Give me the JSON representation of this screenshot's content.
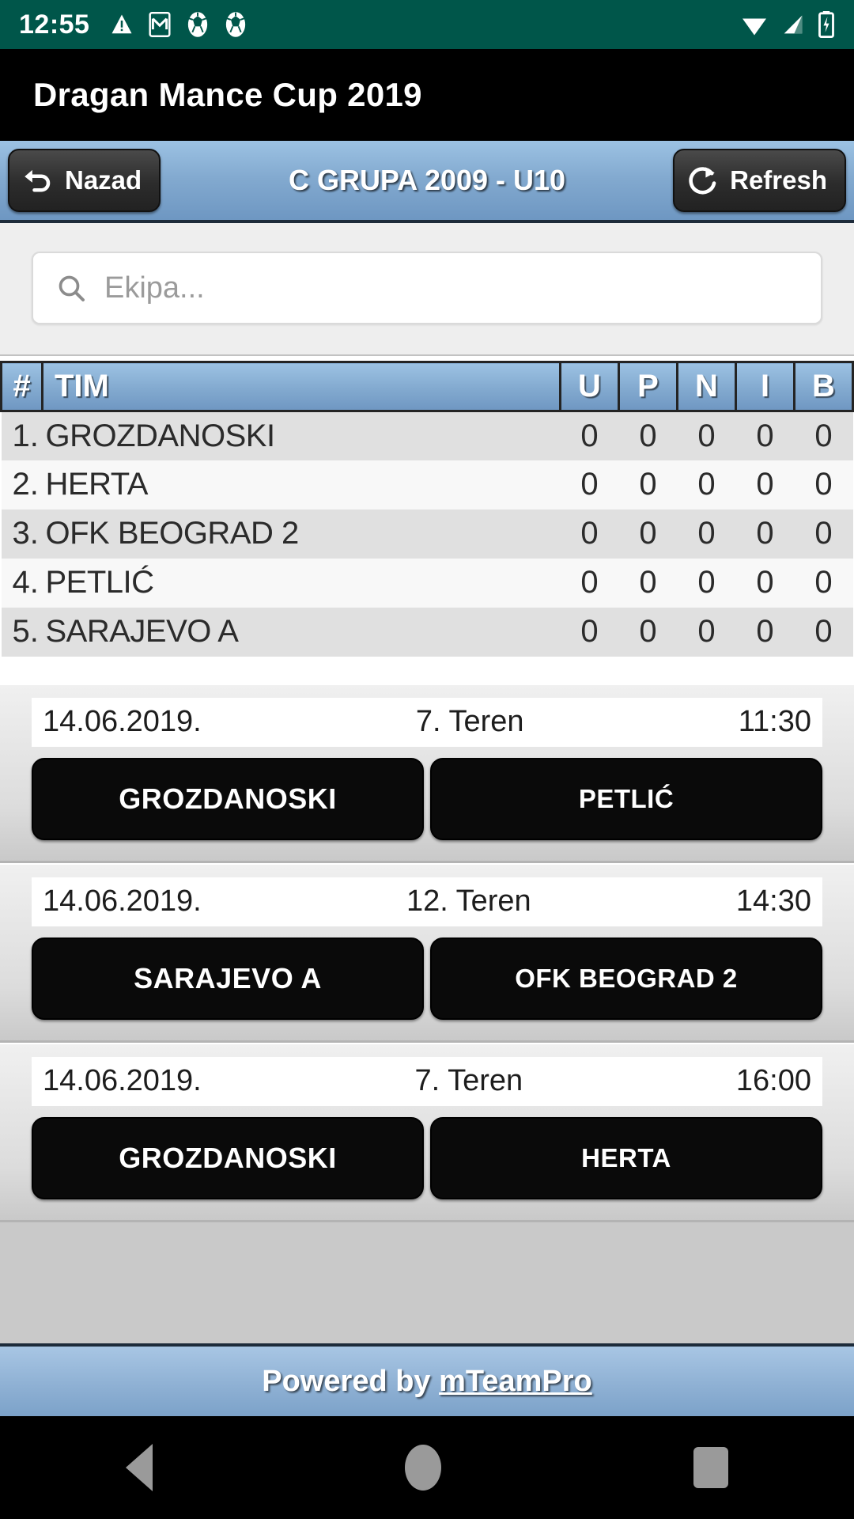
{
  "statusbar": {
    "time": "12:55",
    "left_icons": [
      "warning-icon",
      "gmail-icon",
      "soccer-ball-icon",
      "soccer-ball-icon"
    ],
    "right_icons": [
      "wifi-icon",
      "signal-icon",
      "battery-charging-icon"
    ],
    "background_color": "#00564a"
  },
  "titlebar": {
    "title": "Dragan Mance Cup 2019",
    "background_color": "#000000"
  },
  "toolbar": {
    "back_label": "Nazad",
    "back_icon": "back-arrow-icon",
    "title": "C GRUPA 2009 - U10",
    "refresh_label": "Refresh",
    "refresh_icon": "refresh-icon",
    "accent_color": "#82a9cf"
  },
  "search": {
    "placeholder": "Ekipa...",
    "value": "",
    "icon": "search-icon"
  },
  "standings": {
    "columns": [
      "#",
      "TIM",
      "U",
      "P",
      "N",
      "I",
      "B"
    ],
    "rows": [
      {
        "rank": "1.",
        "team": "GROZDANOSKI",
        "u": "0",
        "p": "0",
        "n": "0",
        "i": "0",
        "b": "0"
      },
      {
        "rank": "2.",
        "team": "HERTA",
        "u": "0",
        "p": "0",
        "n": "0",
        "i": "0",
        "b": "0"
      },
      {
        "rank": "3.",
        "team": "OFK BEOGRAD 2",
        "u": "0",
        "p": "0",
        "n": "0",
        "i": "0",
        "b": "0"
      },
      {
        "rank": "4.",
        "team": "PETLIĆ",
        "u": "0",
        "p": "0",
        "n": "0",
        "i": "0",
        "b": "0"
      },
      {
        "rank": "5.",
        "team": "SARAJEVO A",
        "u": "0",
        "p": "0",
        "n": "0",
        "i": "0",
        "b": "0"
      }
    ]
  },
  "matches": [
    {
      "date": "14.06.2019.",
      "field": "7. Teren",
      "time": "11:30",
      "home": "GROZDANOSKI",
      "away": "PETLIĆ"
    },
    {
      "date": "14.06.2019.",
      "field": "12. Teren",
      "time": "14:30",
      "home": "SARAJEVO A",
      "away": "OFK BEOGRAD 2"
    },
    {
      "date": "14.06.2019.",
      "field": "7. Teren",
      "time": "16:00",
      "home": "GROZDANOSKI",
      "away": "HERTA"
    }
  ],
  "footer": {
    "prefix": "Powered by ",
    "link": "mTeamPro"
  },
  "navbar": {
    "back": "nav-back-icon",
    "home": "nav-home-icon",
    "recents": "nav-recents-icon"
  }
}
